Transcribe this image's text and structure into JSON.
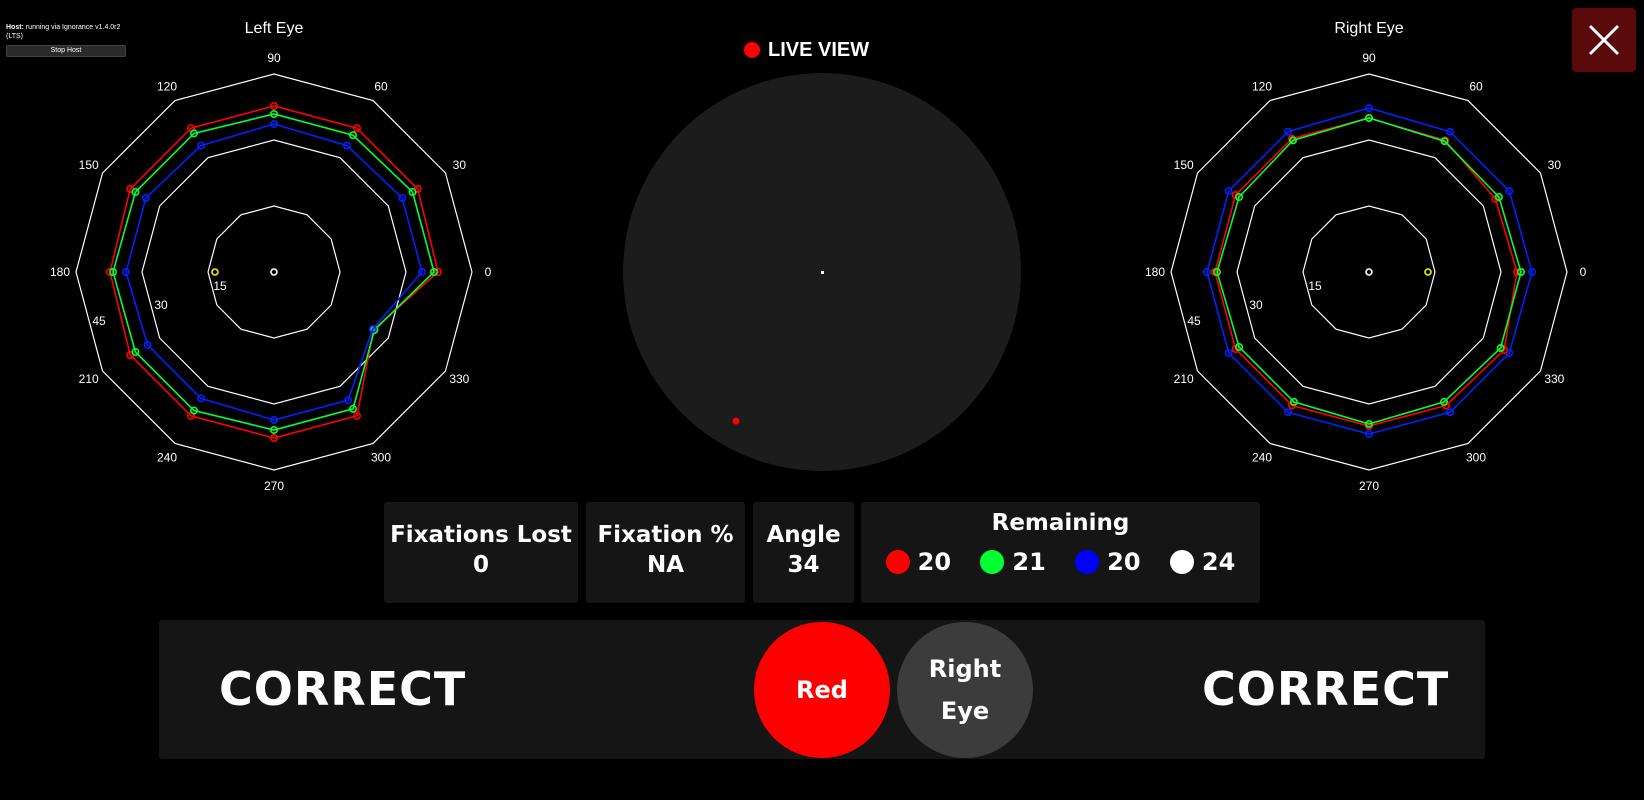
{
  "host": {
    "label": "Host:",
    "status": "running via Ignorance v1.4.0r2 (LTS)",
    "stop_button": "Stop Host"
  },
  "left_eye": {
    "title": "Left Eye",
    "angle_labels": [
      "90",
      "60",
      "30",
      "0",
      "330",
      "300",
      "270",
      "240",
      "210",
      "180",
      "150",
      "120"
    ],
    "ring_labels": [
      "15",
      "30",
      "45"
    ]
  },
  "right_eye": {
    "title": "Right Eye",
    "angle_labels": [
      "90",
      "60",
      "30",
      "0",
      "330",
      "300",
      "270",
      "240",
      "210",
      "180",
      "150",
      "120"
    ],
    "ring_labels": [
      "15",
      "30",
      "45"
    ]
  },
  "live_view": {
    "label": "LIVE VIEW",
    "indicator_color": "#ff0000"
  },
  "stats": {
    "fixations_lost": {
      "label": "Fixations Lost",
      "value": "0"
    },
    "fixation_pct": {
      "label": "Fixation %",
      "value": "NA"
    },
    "angle": {
      "label": "Angle",
      "value": "34"
    }
  },
  "remaining": {
    "title": "Remaining",
    "items": [
      {
        "color": "#ff0000",
        "count": "20"
      },
      {
        "color": "#00ff33",
        "count": "21"
      },
      {
        "color": "#0000ff",
        "count": "20"
      },
      {
        "color": "#ffffff",
        "count": "24"
      }
    ]
  },
  "bottom": {
    "left_status": "CORRECT",
    "right_status": "CORRECT",
    "color_button": "Red",
    "eye_button": "Right Eye"
  },
  "colors": {
    "red": "#ff0000",
    "green": "#00ff33",
    "blue": "#0022ff",
    "yellow": "#ffee00",
    "close_bg": "#5a0a0a"
  }
}
